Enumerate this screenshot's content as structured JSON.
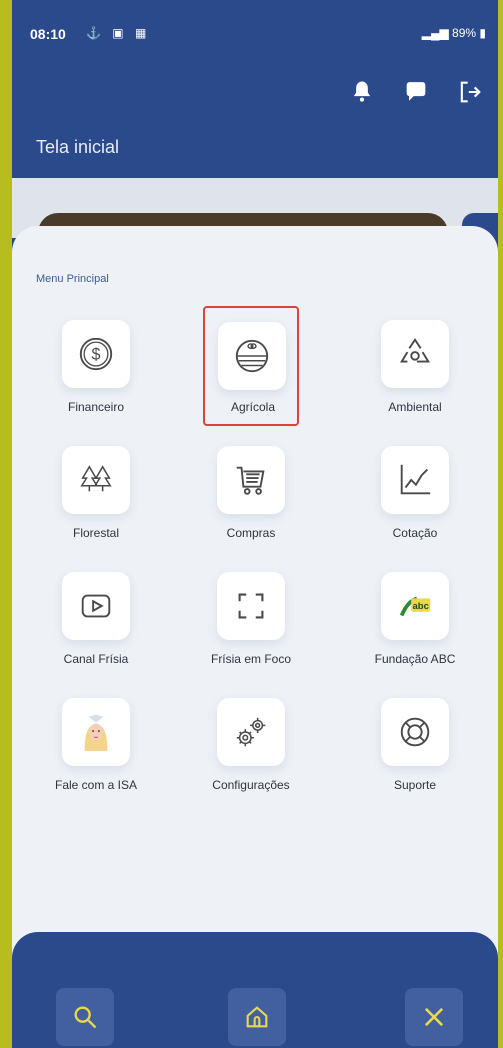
{
  "status_bar": {
    "time": "08:10",
    "battery": "89%"
  },
  "header": {
    "title": "Tela inicial",
    "icons": [
      "bell-icon",
      "chat-icon",
      "logout-icon"
    ]
  },
  "menu": {
    "title": "Menu Principal",
    "items": [
      {
        "label": "Financeiro",
        "icon": "dollar-icon"
      },
      {
        "label": "Agrícola",
        "icon": "agriculture-icon",
        "selected": true
      },
      {
        "label": "Ambiental",
        "icon": "recycle-icon"
      },
      {
        "label": "Florestal",
        "icon": "trees-icon"
      },
      {
        "label": "Compras",
        "icon": "cart-icon"
      },
      {
        "label": "Cotação",
        "icon": "chart-icon"
      },
      {
        "label": "Canal Frísia",
        "icon": "play-icon"
      },
      {
        "label": "Frísia em Foco",
        "icon": "focus-icon"
      },
      {
        "label": "Fundação ABC",
        "icon": "abc-logo"
      },
      {
        "label": "Fale com a ISA",
        "icon": "isa-avatar"
      },
      {
        "label": "Configurações",
        "icon": "gears-icon"
      },
      {
        "label": "Suporte",
        "icon": "lifebuoy-icon"
      }
    ]
  },
  "logo_text": "abc",
  "bottom_nav": {
    "icons": [
      "search-icon",
      "home-icon",
      "close-icon"
    ]
  },
  "colors": {
    "primary": "#2b4a8c",
    "sheet": "#eef2f7",
    "highlight": "#d9443b",
    "accent_yellow": "#e9d84a"
  }
}
